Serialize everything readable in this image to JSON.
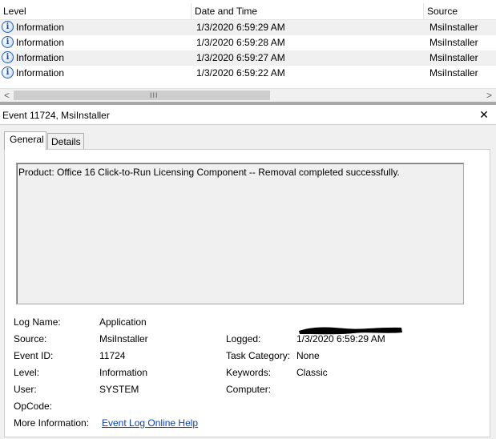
{
  "grid": {
    "columns": [
      "Level",
      "Date and Time",
      "Source"
    ],
    "rows": [
      {
        "level": "Information",
        "date": "1/3/2020 6:59:29 AM",
        "source": "MsiInstaller"
      },
      {
        "level": "Information",
        "date": "1/3/2020 6:59:28 AM",
        "source": "MsiInstaller"
      },
      {
        "level": "Information",
        "date": "1/3/2020 6:59:27 AM",
        "source": "MsiInstaller"
      },
      {
        "level": "Information",
        "date": "1/3/2020 6:59:22 AM",
        "source": "MsiInstaller"
      }
    ],
    "row_icon": "information-icon"
  },
  "scrollbar": {
    "left_arrow": "<",
    "right_arrow": ">",
    "grip": "III"
  },
  "detail": {
    "title": "Event 11724, MsiInstaller",
    "close_label": "✕",
    "tabs": [
      "General",
      "Details"
    ],
    "active_tab": "General",
    "description": "Product: Office 16 Click-to-Run Licensing Component -- Removal completed successfully.",
    "fields": {
      "log_name_label": "Log Name:",
      "log_name": "Application",
      "source_label": "Source:",
      "source": "MsiInstaller",
      "logged_label": "Logged:",
      "logged": "1/3/2020 6:59:29 AM",
      "event_id_label": "Event ID:",
      "event_id": "11724",
      "task_category_label": "Task Category:",
      "task_category": "None",
      "level_label": "Level:",
      "level": "Information",
      "keywords_label": "Keywords:",
      "keywords": "Classic",
      "user_label": "User:",
      "user": "SYSTEM",
      "computer_label": "Computer:",
      "opcode_label": "OpCode:",
      "more_info_label": "More Information:",
      "more_info_link": "Event Log Online Help"
    }
  },
  "colors": {
    "link": "#0b3ec6",
    "alt_row": "#f0f0f0",
    "panel_bg": "#f0f0f0",
    "splitter": "#a8a8a8"
  }
}
